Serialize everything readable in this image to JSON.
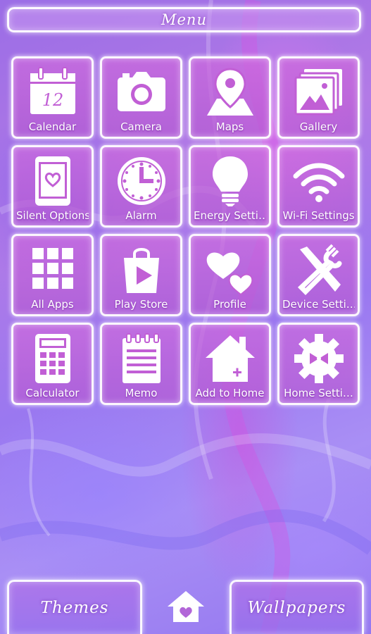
{
  "header": {
    "title": "Menu"
  },
  "calendar_day": "12",
  "tiles": [
    {
      "label": "Calendar",
      "icon": "calendar-icon"
    },
    {
      "label": "Camera",
      "icon": "camera-icon"
    },
    {
      "label": "Maps",
      "icon": "map-pin-icon"
    },
    {
      "label": "Gallery",
      "icon": "gallery-icon"
    },
    {
      "label": "Silent Options",
      "icon": "phone-heart-icon"
    },
    {
      "label": "Alarm",
      "icon": "clock-icon"
    },
    {
      "label": "Energy Setti…",
      "icon": "lightbulb-icon"
    },
    {
      "label": "Wi-Fi Settings",
      "icon": "wifi-icon"
    },
    {
      "label": "All Apps",
      "icon": "grid-icon"
    },
    {
      "label": "Play Store",
      "icon": "play-store-bag-icon"
    },
    {
      "label": "Profile",
      "icon": "hearts-icon"
    },
    {
      "label": "Device Setti…",
      "icon": "tools-icon"
    },
    {
      "label": "Calculator",
      "icon": "calculator-icon"
    },
    {
      "label": "Memo",
      "icon": "memo-icon"
    },
    {
      "label": "Add to Home",
      "icon": "add-home-icon"
    },
    {
      "label": "Home Setti…",
      "icon": "gear-icon"
    }
  ],
  "bottom": {
    "themes_label": "Themes",
    "wallpapers_label": "Wallpapers",
    "home_icon": "home-heart-icon"
  },
  "colors": {
    "tile_fill": "#c766d8",
    "tile_border": "#ffffff",
    "icon_accent": "#c15fd5",
    "background": "#a07ae8"
  }
}
